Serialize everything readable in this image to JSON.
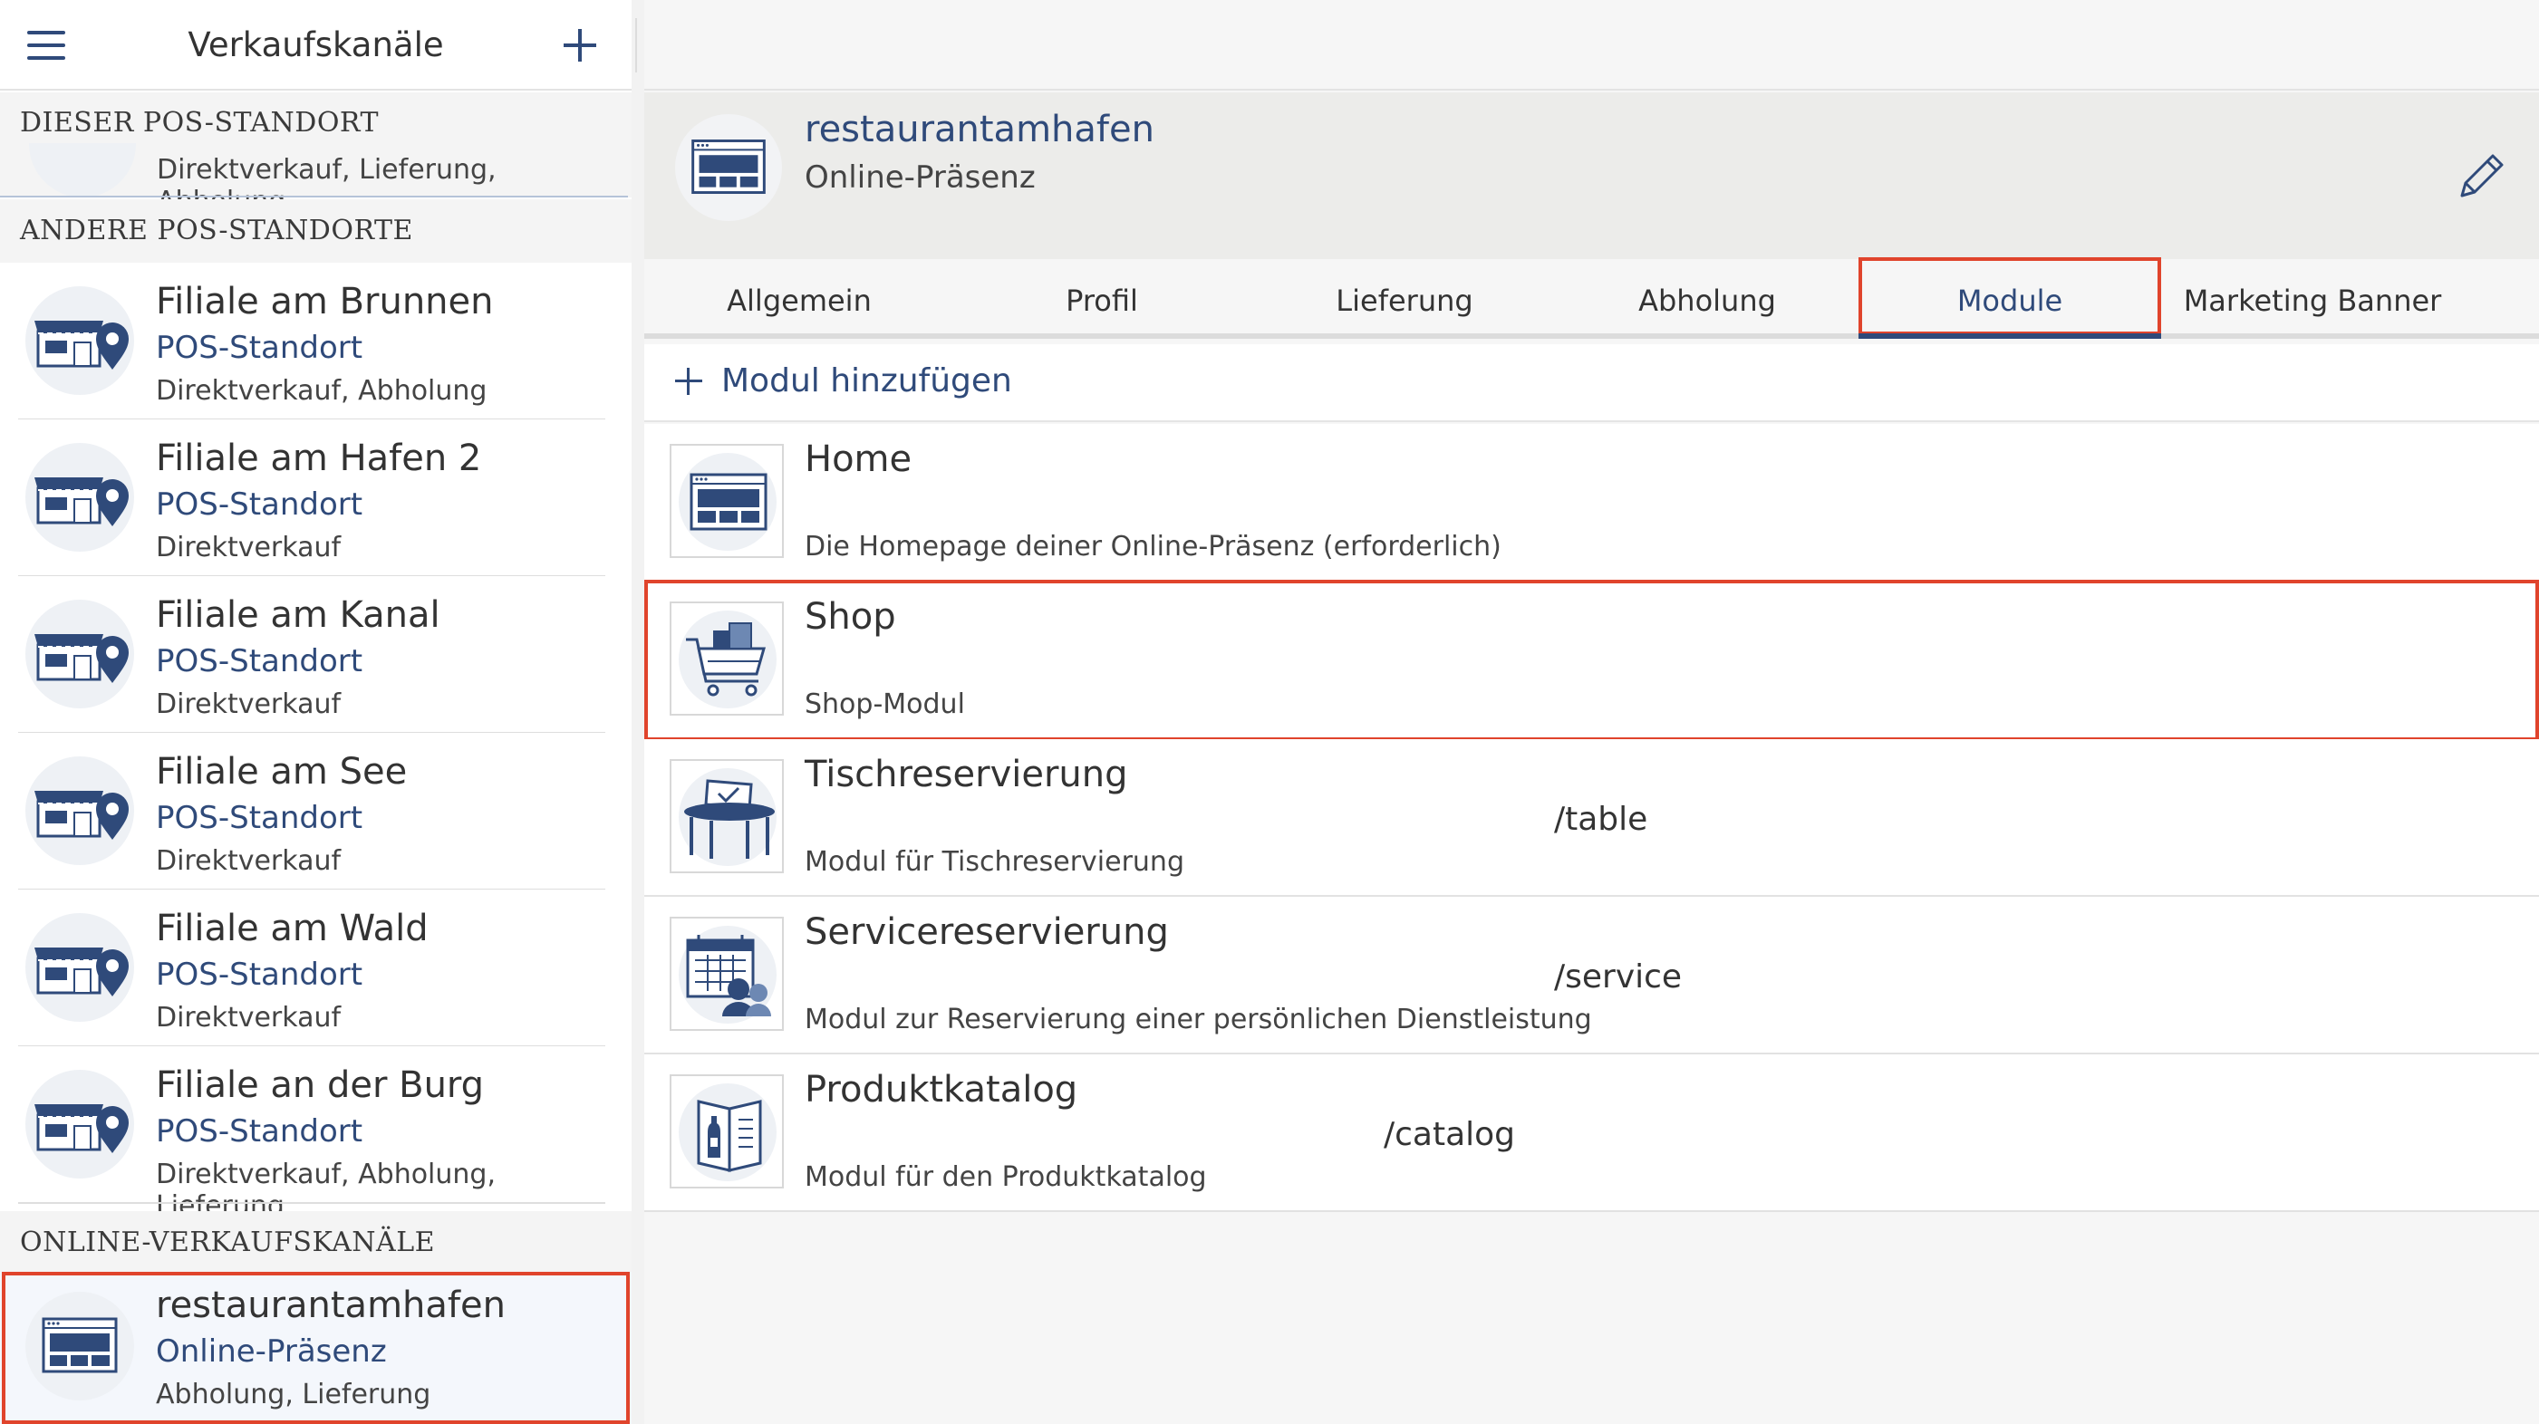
{
  "sidebar": {
    "title": "Verkaufskanäle",
    "sections": {
      "this_location": {
        "header": "DIESER POS-STANDORT",
        "subtitle": "Direktverkauf, Lieferung, Abholung"
      },
      "other_locations": {
        "header": "ANDERE POS-STANDORTE"
      },
      "online_channels": {
        "header": "ONLINE-VERKAUFSKANÄLE"
      }
    },
    "locations": [
      {
        "name": "Filiale am Brunnen",
        "type": "POS-Standort",
        "desc": "Direktverkauf, Abholung"
      },
      {
        "name": "Filiale am Hafen 2",
        "type": "POS-Standort",
        "desc": "Direktverkauf"
      },
      {
        "name": "Filiale am Kanal",
        "type": "POS-Standort",
        "desc": "Direktverkauf"
      },
      {
        "name": "Filiale am See",
        "type": "POS-Standort",
        "desc": "Direktverkauf"
      },
      {
        "name": "Filiale am Wald",
        "type": "POS-Standort",
        "desc": "Direktverkauf"
      },
      {
        "name": "Filiale an der Burg",
        "type": "POS-Standort",
        "desc": "Direktverkauf, Abholung, Lieferung"
      }
    ],
    "online": [
      {
        "name": "restaurantamhafen",
        "type": "Online-Präsenz",
        "desc": "Abholung, Lieferung"
      }
    ]
  },
  "channel": {
    "name": "restaurantamhafen",
    "type": "Online-Präsenz"
  },
  "tabs": [
    {
      "label": "Allgemein"
    },
    {
      "label": "Profil"
    },
    {
      "label": "Lieferung"
    },
    {
      "label": "Abholung"
    },
    {
      "label": "Module"
    },
    {
      "label": "Marketing Banner"
    }
  ],
  "active_tab": "Module",
  "add_module_label": "Modul hinzufügen",
  "modules": [
    {
      "name": "Home",
      "path": "",
      "desc": "Die Homepage deiner Online-Präsenz (erforderlich)",
      "icon": "website-icon"
    },
    {
      "name": "Shop",
      "path": "",
      "desc": "Shop-Modul",
      "icon": "shopping-cart-icon"
    },
    {
      "name": "Tischreservierung",
      "path": "/table",
      "desc": "Modul für Tischreservierung",
      "icon": "table-reservation-icon"
    },
    {
      "name": "Servicereservierung",
      "path": "/service",
      "desc": "Modul zur Reservierung einer persönlichen Dienstleistung",
      "icon": "service-calendar-icon"
    },
    {
      "name": "Produktkatalog",
      "path": "/catalog",
      "desc": "Modul für den Produktkatalog",
      "icon": "catalog-icon"
    }
  ],
  "colors": {
    "accent": "#2f4a7a",
    "highlight": "#e0442c",
    "icon_bg": "#eef1f5"
  }
}
